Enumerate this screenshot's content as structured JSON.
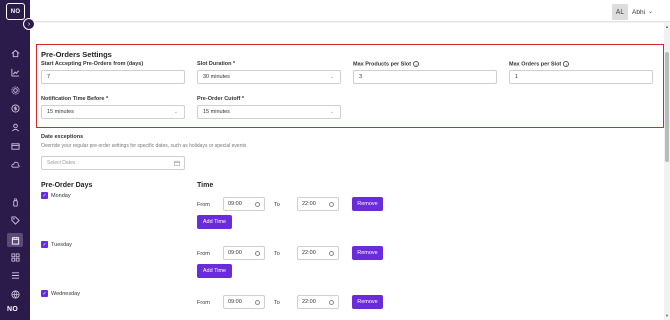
{
  "brand": {
    "logo_text": "NO",
    "logo_bottom": "NO"
  },
  "user": {
    "initials": "AL",
    "name": "Abhi"
  },
  "settings": {
    "title": "Pre-Orders Settings",
    "start_accepting": {
      "label": "Start Accepting Pre-Orders from (days)",
      "value": "7"
    },
    "slot_duration": {
      "label": "Slot Duration *",
      "value": "30 minutes"
    },
    "max_products": {
      "label": "Max Products per Slot",
      "value": "3"
    },
    "max_orders": {
      "label": "Max Orders per Slot",
      "value": "1"
    },
    "notification_time": {
      "label": "Notification Time Before *",
      "value": "15 minutes"
    },
    "cutoff": {
      "label": "Pre-Order Cutoff *",
      "value": "15 minutes"
    }
  },
  "date_exceptions": {
    "title": "Date exceptions",
    "helper": "Override your regular pre-order settings for specific dates, such as holidays or special events",
    "placeholder": "Select Dates"
  },
  "schedule": {
    "days_heading": "Pre-Order Days",
    "time_heading": "Time",
    "from_label": "From",
    "to_label": "To",
    "remove_label": "Remove",
    "add_time_label": "Add Time",
    "days": [
      {
        "name": "Monday",
        "from": "09:00",
        "to": "22:00"
      },
      {
        "name": "Tuesday",
        "from": "09:00",
        "to": "22:00"
      },
      {
        "name": "Wednesday",
        "from": "09:00",
        "to": "22:00"
      }
    ]
  },
  "colors": {
    "sidebar": "#2a1b4a",
    "accent": "#6a2bd9",
    "highlight_border": "#d62828"
  }
}
